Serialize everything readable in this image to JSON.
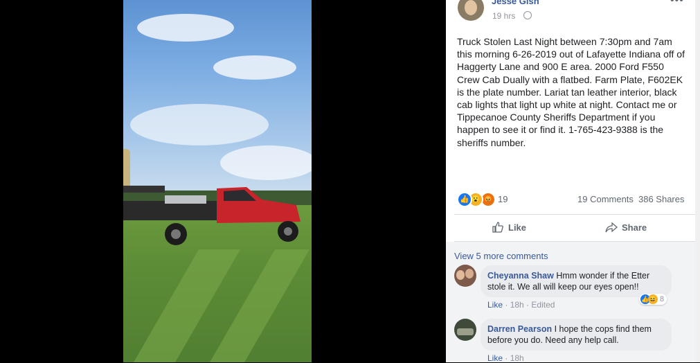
{
  "post": {
    "author": "Jesse Gish",
    "time": "19 hrs",
    "text": "Truck Stolen Last Night between 7:30pm and 7am this morning 6-26-2019 out of Lafayette Indiana off of Haggerty Lane and 900 E area. 2000 Ford F550 Crew Cab Dually with a flatbed. Farm Plate, F602EK is the plate number. Lariat tan leather interior, black cab lights that light up white at night. Contact me or Tippecanoe County Sheriffs Department if you happen to see it or find it. 1-765-423-9388 is the sheriffs number.",
    "reaction_count": "19",
    "comments_count": "19 Comments",
    "shares_count": "386 Shares",
    "reaction_types": [
      "like-icon",
      "wow-icon",
      "angry-icon"
    ]
  },
  "actions": {
    "like_label": "Like",
    "share_label": "Share"
  },
  "comments": {
    "view_more": "View 5 more comments",
    "items": [
      {
        "name": "Cheyanna Shaw",
        "text": "Hmm wonder if the Etter stole it. We all will keep our eyes open!!",
        "like": "Like",
        "time": "18h",
        "edited": "Edited",
        "reaction_count": "8"
      },
      {
        "name": "Darren Pearson",
        "text": "I hope the cops find them before you do. Need any help call.",
        "like": "Like",
        "time": "18h"
      }
    ]
  },
  "colors": {
    "link": "#385898",
    "like_blue": "#1877f2",
    "angry": "#e9710f",
    "wow": "#f7b125",
    "truck_red": "#c8242b"
  }
}
